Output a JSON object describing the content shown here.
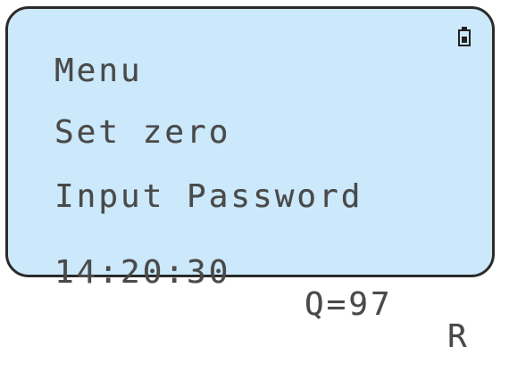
{
  "display": {
    "line1": "Menu",
    "line2": "Set zero",
    "line3": "Input Password",
    "status": {
      "time": "14:20:30",
      "quality": "Q=97",
      "flag": "R"
    }
  },
  "battery": {
    "icon": "battery-icon",
    "level": 0.6
  },
  "colors": {
    "screen_background": "#cce9fb",
    "text": "#4a4a4a",
    "border": "#2b2b2b"
  }
}
